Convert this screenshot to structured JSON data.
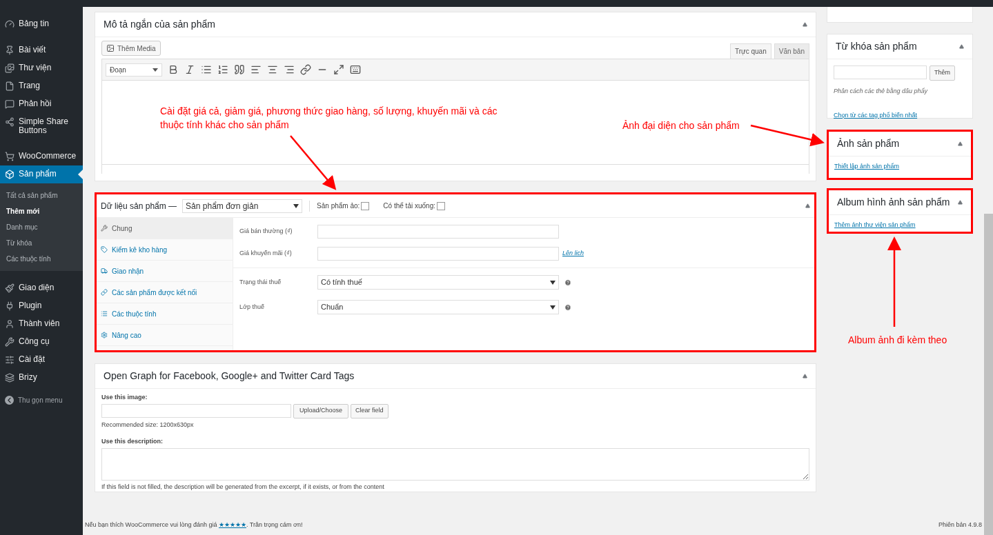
{
  "sidebar": {
    "items": [
      {
        "label": "Bảng tin",
        "selected": false
      },
      {
        "label": "Bài viết",
        "selected": false
      },
      {
        "label": "Thư viện",
        "selected": false
      },
      {
        "label": "Trang",
        "selected": false
      },
      {
        "label": "Phản hồi",
        "selected": false
      },
      {
        "label": "Simple Share Buttons",
        "selected": false
      },
      {
        "label": "WooCommerce",
        "selected": false
      },
      {
        "label": "Sản phẩm",
        "selected": true,
        "children": [
          {
            "label": "Tất cả sản phẩm",
            "selected": false
          },
          {
            "label": "Thêm mới",
            "selected": true
          },
          {
            "label": "Danh mục",
            "selected": false
          },
          {
            "label": "Từ khóa",
            "selected": false
          },
          {
            "label": "Các thuộc tính",
            "selected": false
          }
        ]
      },
      {
        "label": "Giao diện",
        "selected": false
      },
      {
        "label": "Plugin",
        "selected": false
      },
      {
        "label": "Thành viên",
        "selected": false
      },
      {
        "label": "Công cụ",
        "selected": false
      },
      {
        "label": "Cài đặt",
        "selected": false
      },
      {
        "label": "Brizy",
        "selected": false
      }
    ],
    "collapse": "Thu gọn menu"
  },
  "short_description": {
    "title": "Mô tả ngắn của sản phẩm",
    "add_media": "Thêm Media",
    "tabs": [
      {
        "label": "Trực quan",
        "selected": true
      },
      {
        "label": "Văn bản",
        "selected": false
      }
    ],
    "format": "Đoạn"
  },
  "product_data": {
    "title": "Dữ liệu sản phẩm —",
    "type": "Sản phẩm đơn giản",
    "options": [
      {
        "label": "Sản phẩm ảo:",
        "checked": false
      },
      {
        "label": "Có thể tải xuống:",
        "checked": false
      }
    ],
    "tabs": [
      {
        "label": "Chung",
        "selected": true
      },
      {
        "label": "Kiểm kê kho hàng",
        "selected": false
      },
      {
        "label": "Giao nhận",
        "selected": false
      },
      {
        "label": "Các sản phẩm được kết nối",
        "selected": false
      },
      {
        "label": "Các thuộc tính",
        "selected": false
      },
      {
        "label": "Nâng cao",
        "selected": false
      }
    ],
    "price_fields": [
      {
        "label": "Giá bán thường (₫)"
      },
      {
        "label": "Giá khuyến mãi (₫)",
        "link": "Lên lịch"
      }
    ],
    "tax_fields": [
      {
        "label": "Trạng thái thuế",
        "value": "Có tính thuế"
      },
      {
        "label": "Lớp thuế",
        "value": "Chuẩn"
      }
    ]
  },
  "open_graph": {
    "title": "Open Graph for Facebook, Google+ and Twitter Card Tags",
    "image_label": "Use this image:",
    "upload": "Upload/Choose",
    "clear": "Clear field",
    "size_note": "Recommended size: 1200x630px",
    "description_label": "Use this description:",
    "description_note": "If this field is not filled, the description will be generated from the excerpt, if it exists, or from the content"
  },
  "tags_box": {
    "title": "Từ khóa sản phẩm",
    "add": "Thêm",
    "hint": "Phân cách các thẻ bằng dấu phẩy",
    "link": "Chọn từ các tag phổ biến nhất"
  },
  "image_box": {
    "title": "Ảnh sản phẩm",
    "link": "Thiết lập ảnh sản phẩm"
  },
  "gallery_box": {
    "title": "Album hình ảnh sản phẩm",
    "link": "Thêm ảnh thư viện sản phẩm"
  },
  "footer": {
    "before": "Nếu bạn thích ",
    "brand": "WooCommerce",
    "middle": " vui lòng đánh giá ",
    "link": "★★★★★",
    "after": ". Trân trọng cám ơn!",
    "version": "Phiên bản 4.9.8"
  },
  "annotations": [
    {
      "text": "Cài đặt giá cả, giảm giá, phương thức giao hàng, số lượng, khuyến mãi và các thuộc tính khác cho sản phẩm"
    },
    {
      "text": "Ảnh đại diện cho sản phẩm"
    },
    {
      "text": "Album ảnh đi kèm theo"
    }
  ]
}
